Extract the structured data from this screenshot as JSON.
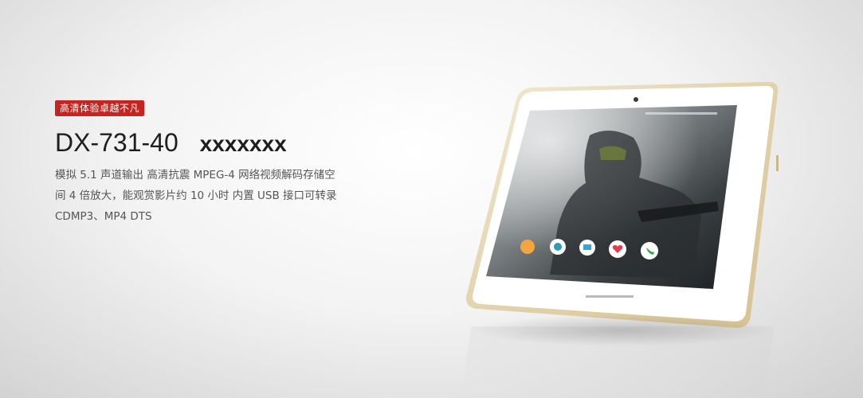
{
  "badge": "高清体验卓越不凡",
  "title": {
    "model": "DX-731-40",
    "suffix": "xxxxxxx"
  },
  "description": [
    "模拟 5.1 声道输出 高清抗震 MPEG-4 网络视频解码存储空",
    "间 4 倍放大，能观赏影片约 10 小时 内置 USB 接口可转录",
    "CDMP3、MP4 DTS"
  ],
  "colors": {
    "badge_bg": "#c8241f",
    "tablet_frame": "#e6d8b6",
    "tablet_bezel": "#ffffff"
  },
  "tablet": {
    "icons": [
      "apps-icon",
      "camera-app-icon",
      "mail-app-icon",
      "heart-app-icon",
      "phone-app-icon"
    ]
  }
}
